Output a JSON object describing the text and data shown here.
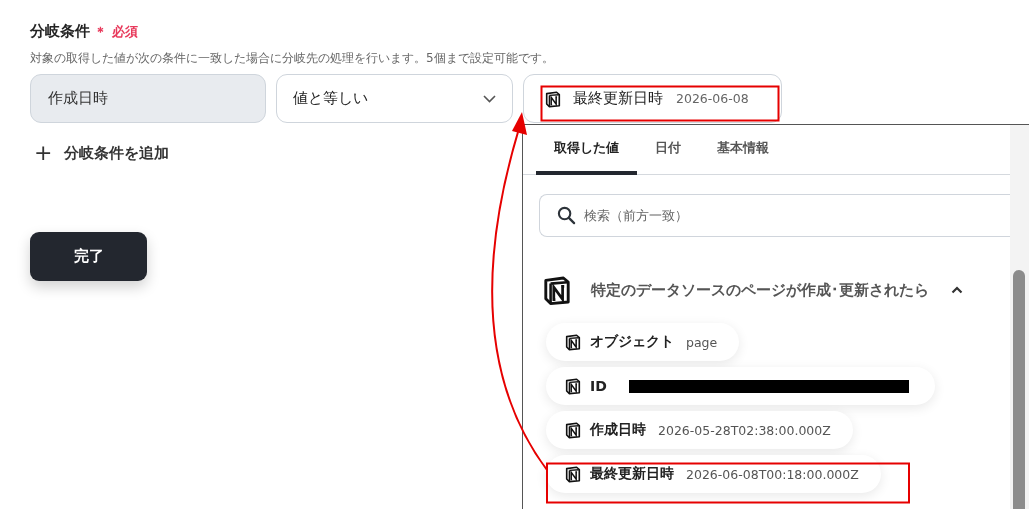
{
  "condition": {
    "label": "分岐条件",
    "required_mark": "＊",
    "required_text": "必須",
    "description": "対象の取得した値が次の条件に一致した場合に分岐先の処理を行います。5個まで設定可能です。",
    "field": {
      "value": "作成日時"
    },
    "operator": {
      "value": "値と等しい"
    },
    "value_chip": {
      "name": "最終更新日時",
      "value": "2026-06-08"
    }
  },
  "add_button": {
    "icon": "+",
    "label": "分岐条件を追加"
  },
  "done_button": {
    "label": "完了"
  },
  "picker": {
    "tabs": [
      {
        "label": "取得した値",
        "selected": true
      },
      {
        "label": "日付",
        "selected": false
      },
      {
        "label": "基本情報",
        "selected": false
      }
    ],
    "search": {
      "placeholder": "検索（前方一致）"
    },
    "section": {
      "title": "特定のデータソースのページが作成･更新されたら",
      "expanded": true,
      "items": [
        {
          "kind": "value",
          "name": "オブジェクト",
          "value": "page"
        },
        {
          "kind": "redacted",
          "name": "ID"
        },
        {
          "kind": "value",
          "name": "作成日時",
          "value": "2026-05-28T02:38:00.000Z"
        },
        {
          "kind": "value",
          "name": "最終更新日時",
          "value": "2026-06-08T00:18:00.000Z"
        }
      ]
    }
  }
}
